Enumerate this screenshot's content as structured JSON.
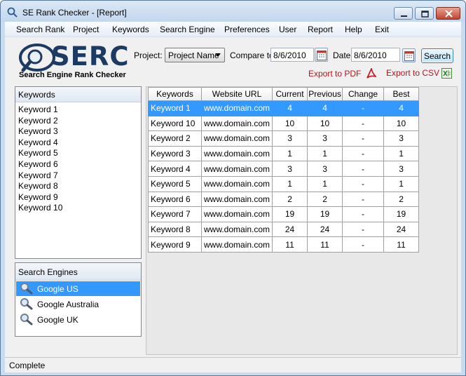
{
  "window": {
    "title": "SE Rank Checker - [Report]"
  },
  "menu": [
    {
      "label": "Search Rank",
      "key": "S"
    },
    {
      "label": "Project",
      "key": "P"
    },
    {
      "label": "Keywords",
      "key": "K"
    },
    {
      "label": "Search Engine",
      "key": "E"
    },
    {
      "label": "Preferences",
      "key": "P"
    },
    {
      "label": "User",
      "key": "U"
    },
    {
      "label": "Report",
      "key": "R"
    },
    {
      "label": "Help",
      "key": ""
    },
    {
      "label": "Exit",
      "key": ""
    }
  ],
  "logo": {
    "name": "SERC",
    "tagline": "Search Engine Rank Checker"
  },
  "toolbar": {
    "project_label": "Project:",
    "project_value": "Project Name",
    "compare_label": "Compare to:",
    "compare_value": "8/6/2010",
    "date_label": "Date:",
    "date_value": "8/6/2010",
    "search_label": "Search",
    "export_pdf": "Export to PDF",
    "export_csv": "Export to CSV"
  },
  "keywords_panel": {
    "title": "Keywords",
    "items": [
      "Keyword 1",
      "Keyword 2",
      "Keyword 3",
      "Keyword 4",
      "Keyword 5",
      "Keyword 6",
      "Keyword 7",
      "Keyword 8",
      "Keyword 9",
      "Keyword 10"
    ]
  },
  "engines_panel": {
    "title": "Search Engines",
    "items": [
      "Google US",
      "Google Australia",
      "Google UK"
    ],
    "selected": 0
  },
  "grid": {
    "columns": [
      "Keywords",
      "Website URL",
      "Current",
      "Previous",
      "Change",
      "Best"
    ],
    "rows": [
      [
        "Keyword 1",
        "www.domain.com",
        "4",
        "4",
        "-",
        "4"
      ],
      [
        "Keyword 10",
        "www.domain.com",
        "10",
        "10",
        "-",
        "10"
      ],
      [
        "Keyword 2",
        "www.domain.com",
        "3",
        "3",
        "-",
        "3"
      ],
      [
        "Keyword 3",
        "www.domain.com",
        "1",
        "1",
        "-",
        "1"
      ],
      [
        "Keyword 4",
        "www.domain.com",
        "3",
        "3",
        "-",
        "3"
      ],
      [
        "Keyword 5",
        "www.domain.com",
        "1",
        "1",
        "-",
        "1"
      ],
      [
        "Keyword 6",
        "www.domain.com",
        "2",
        "2",
        "-",
        "2"
      ],
      [
        "Keyword 7",
        "www.domain.com",
        "19",
        "19",
        "-",
        "19"
      ],
      [
        "Keyword 8",
        "www.domain.com",
        "24",
        "24",
        "-",
        "24"
      ],
      [
        "Keyword 9",
        "www.domain.com",
        "11",
        "11",
        "-",
        "11"
      ]
    ],
    "selected_row": 0
  },
  "status": {
    "text": "Complete"
  },
  "colors": {
    "selection": "#3399ff",
    "export_text": "#b0171f",
    "logo": "#1c3a62"
  },
  "icons": {
    "app": "magnifier-icon",
    "calendar": "calendar-icon",
    "pdf": "pdf-icon",
    "csv": "excel-icon",
    "engine": "magnifier-icon"
  }
}
